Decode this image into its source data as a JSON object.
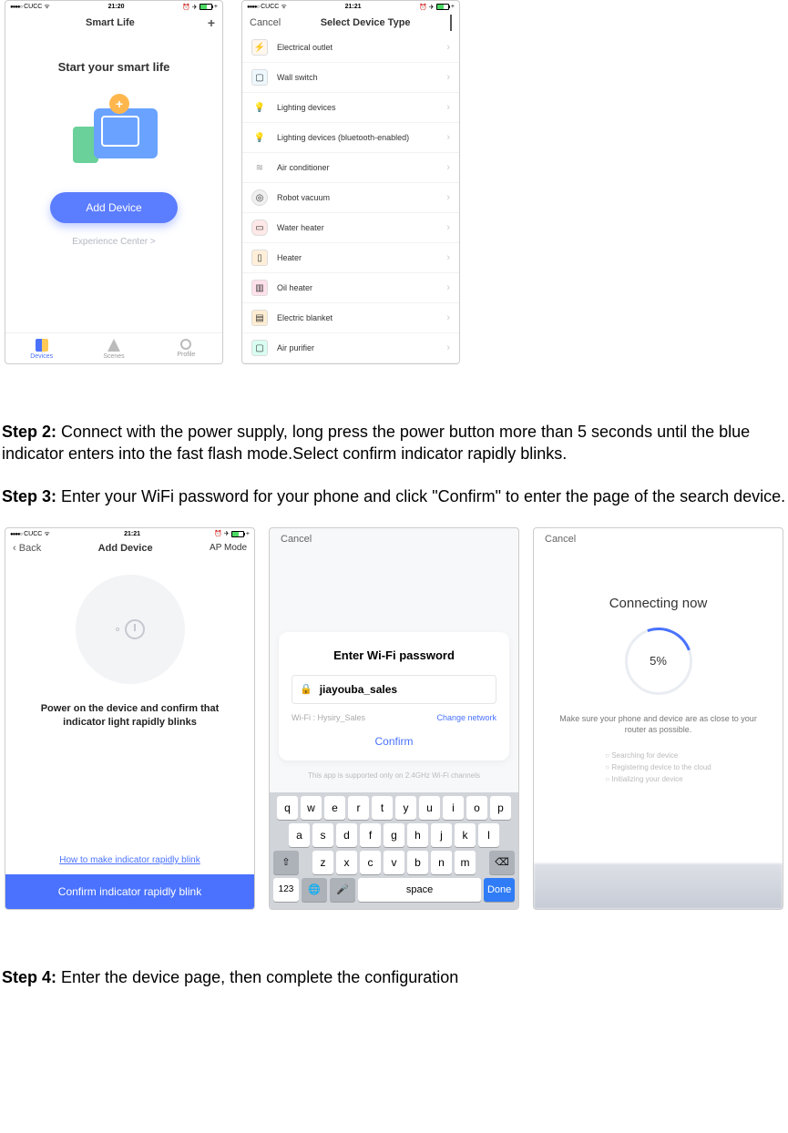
{
  "status": {
    "carrier": "CUCC",
    "time1": "21:20",
    "time2": "21:21"
  },
  "phone1": {
    "title": "Smart Life",
    "headline": "Start your smart life",
    "add_btn": "Add Device",
    "experience": "Experience Center >",
    "tabs": [
      "Devices",
      "Scenes",
      "Profile"
    ]
  },
  "phone2": {
    "cancel": "Cancel",
    "title": "Select Device Type",
    "items": [
      "Electrical outlet",
      "Wall switch",
      "Lighting devices",
      "Lighting devices (bluetooth-enabled)",
      "Air conditioner",
      "Robot vacuum",
      "Water heater",
      "Heater",
      "Oil heater",
      "Electric blanket",
      "Air purifier"
    ]
  },
  "steps": {
    "s2_label": "Step 2:",
    "s2": " Connect with the power supply, long press the power button more than 5 seconds until the blue indicator enters into the fast flash mode.Select confirm indicator rapidly blinks.",
    "s3_label": "Step 3:",
    "s3": " Enter your WiFi password for your phone and click \"Confirm\" to enter the page of the search device.",
    "s4_label": "Step 4:",
    "s4": " Enter the device page, then complete the configuration"
  },
  "phone3": {
    "back": "Back",
    "title": "Add Device",
    "ap": "AP Mode",
    "text": "Power on the device and confirm that indicator light rapidly blinks",
    "link": "How to make indicator rapidly blink",
    "btn": "Confirm indicator rapidly blink"
  },
  "phone4": {
    "cancel": "Cancel",
    "title": "Enter Wi-Fi password",
    "ssid_value": "jiayouba_sales",
    "wifi_label": "Wi-Fi : Hysiry_Sales",
    "change": "Change network",
    "confirm": "Confirm",
    "note": "This app is supported only on 2.4GHz Wi-Fi channels",
    "kb_row1": [
      "q",
      "w",
      "e",
      "r",
      "t",
      "y",
      "u",
      "i",
      "o",
      "p"
    ],
    "kb_row2": [
      "a",
      "s",
      "d",
      "f",
      "g",
      "h",
      "j",
      "k",
      "l"
    ],
    "kb_row3": [
      "z",
      "x",
      "c",
      "v",
      "b",
      "n",
      "m"
    ],
    "space": "space",
    "done": "Done",
    "num": "123"
  },
  "phone5": {
    "cancel": "Cancel",
    "title": "Connecting now",
    "percent": "5%",
    "note": "Make sure your phone and device are as close to your router as possible.",
    "status": [
      "Searching for device",
      "Registering device to the cloud",
      "Initializing your device"
    ]
  }
}
